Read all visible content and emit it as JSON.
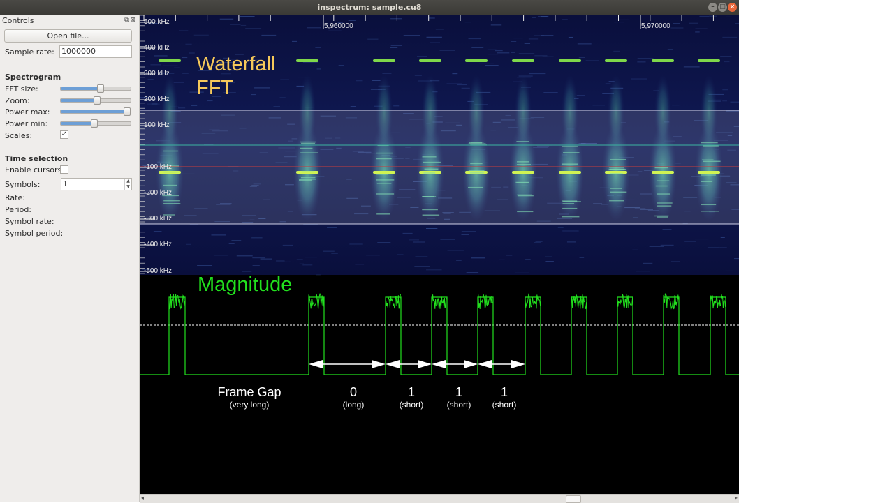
{
  "window": {
    "title": "inspectrum: sample.cu8"
  },
  "controls": {
    "header": "Controls",
    "open_file_label": "Open file...",
    "sample_rate_label": "Sample rate:",
    "sample_rate_value": "1000000",
    "spectrogram_heading": "Spectrogram",
    "fft_size_label": "FFT size:",
    "fft_size_level": 0.56,
    "zoom_label": "Zoom:",
    "zoom_level": 0.51,
    "power_max_label": "Power max:",
    "power_max_level": 0.94,
    "power_min_label": "Power min:",
    "power_min_level": 0.47,
    "scales_label": "Scales:",
    "scales_checked": "✓",
    "time_selection_heading": "Time selection",
    "enable_cursors_label": "Enable cursors:",
    "symbols_label": "Symbols:",
    "symbols_value": "1",
    "rate_label": "Rate:",
    "period_label": "Period:",
    "symbol_rate_label": "Symbol rate:",
    "symbol_period_label": "Symbol period:"
  },
  "spectrogram": {
    "freq_labels": [
      "500 kHz",
      "400 kHz",
      "300 kHz",
      "200 kHz",
      "100 kHz",
      "-100 kHz",
      "-200 kHz",
      "-300 kHz",
      "-400 kHz",
      "-500 kHz"
    ],
    "time_labels": [
      "5,960000",
      "5,970000"
    ],
    "waterfall_line1": "Waterfall",
    "waterfall_line2": "FFT",
    "magnitude_label": "Magnitude"
  },
  "annotations": [
    {
      "value": "Frame Gap",
      "note": "(very long)"
    },
    {
      "value": "0",
      "note": "(long)"
    },
    {
      "value": "1",
      "note": "(short)"
    },
    {
      "value": "1",
      "note": "(short)"
    },
    {
      "value": "1",
      "note": "(short)"
    }
  ],
  "colors": {
    "waterfall_bg": "#0b1040",
    "signal_green": "#22e01e",
    "label_yellow": "#f5c85a",
    "selection_line": "#d0d0e8",
    "center_red": "#c83c3c",
    "center_teal": "#3cb4a0"
  }
}
